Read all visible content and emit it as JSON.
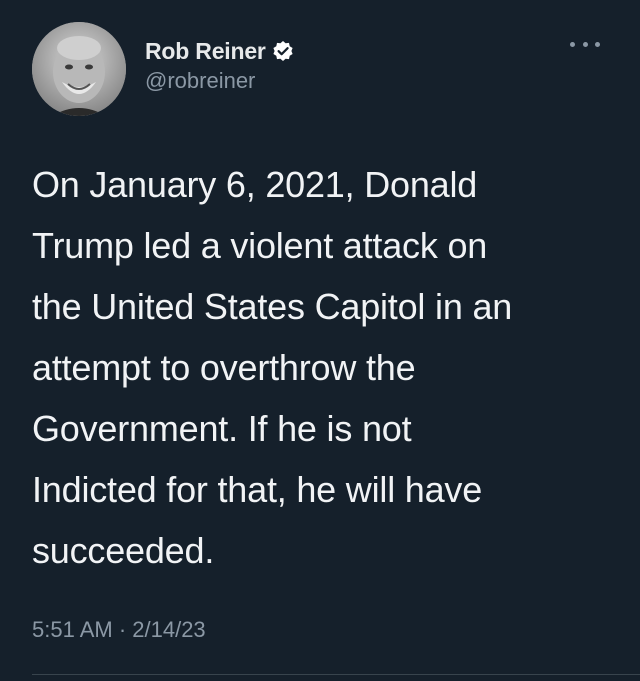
{
  "author": {
    "display_name": "Rob Reiner",
    "handle": "@robreiner",
    "verified": true,
    "avatar_icon": "profile-photo"
  },
  "menu": {
    "icon": "more-options-icon"
  },
  "tweet": {
    "text": "On January 6, 2021, Donald\nTrump led a violent attack on\nthe United States Capitol in an\nattempt to overthrow the\nGovernment. If he is not\nIndicted for that, he will have\nsucceeded.",
    "timestamp": "5:51 AM · 2/14/23"
  },
  "colors": {
    "background": "#15202b",
    "text": "#e7e9ea",
    "secondary_text": "#8b98a5",
    "verified_badge": "#ffffff"
  }
}
